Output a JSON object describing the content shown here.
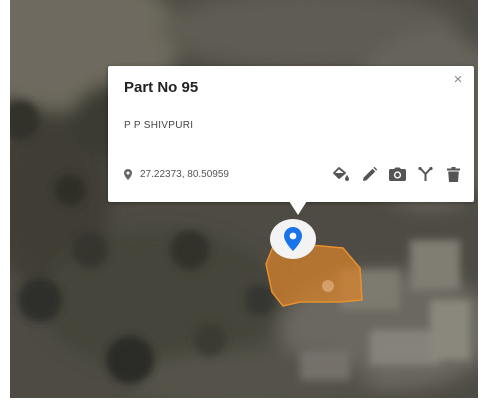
{
  "popup": {
    "title": "Part No 95",
    "subtitle": "P P SHIVPURI",
    "coordinates": "27.22373, 80.50959",
    "close_glyph": "×",
    "tools": [
      {
        "name": "fill-color-icon"
      },
      {
        "name": "edit-icon"
      },
      {
        "name": "camera-icon"
      },
      {
        "name": "route-icon"
      },
      {
        "name": "delete-icon"
      }
    ]
  },
  "colors": {
    "marker_pin": "#1a73e8",
    "polygon_fill": "#d9832a",
    "popup_bg": "#ffffff"
  }
}
